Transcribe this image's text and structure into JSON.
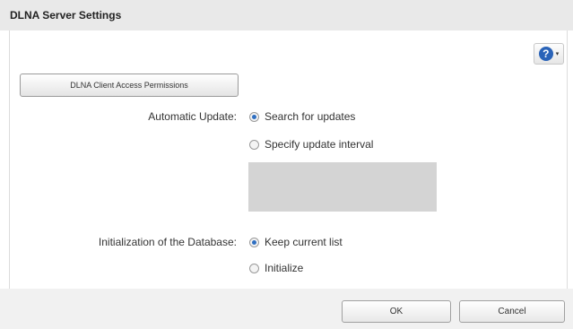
{
  "dialog": {
    "title": "DLNA Server Settings"
  },
  "help": {
    "symbol": "?",
    "caret": "▾"
  },
  "client_access_button": "DLNA Client Access Permissions",
  "automatic_update": {
    "label": "Automatic Update:",
    "options": [
      "Search for updates",
      "Specify update interval"
    ],
    "selected": "Search for updates",
    "interval_value": ""
  },
  "database_init": {
    "label": "Initialization of the Database:",
    "options": [
      "Keep current list",
      "Initialize"
    ],
    "selected": "Keep current list"
  },
  "footer": {
    "ok": "OK",
    "cancel": "Cancel"
  },
  "colors": {
    "accent": "#2a63b8",
    "titlebar": "#e9e9e9",
    "disabled_field": "#d4d4d4"
  }
}
